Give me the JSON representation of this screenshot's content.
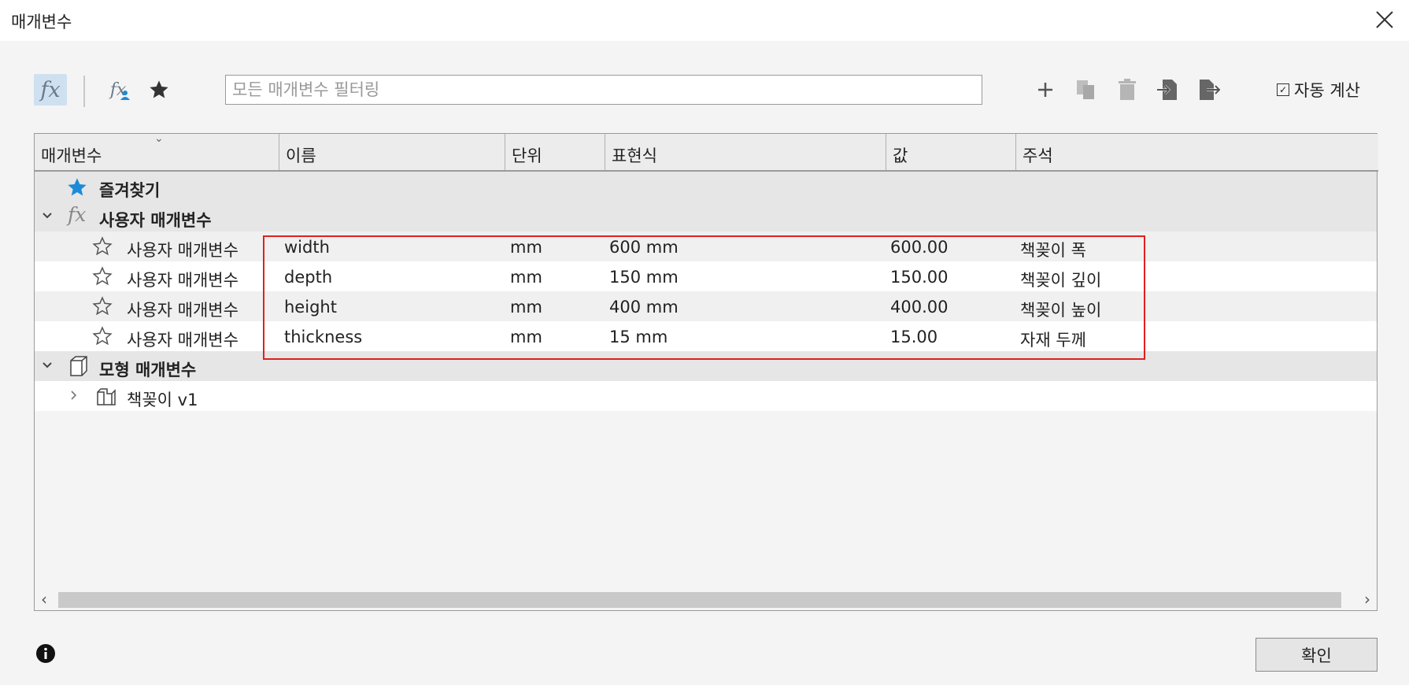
{
  "window": {
    "title": "매개변수",
    "close_icon": "close-icon"
  },
  "toolbar": {
    "filter_placeholder": "모든 매개변수 필터링",
    "fx_label": "fx",
    "user_fx_label": "fx",
    "auto_calc_label": "자동 계산",
    "auto_calc_checked": true,
    "checkmark": "✓"
  },
  "columns": [
    "매개변수",
    "이름",
    "단위",
    "표현식",
    "값",
    "주석"
  ],
  "groups": {
    "favorites": {
      "label": "즐겨찾기",
      "icon": "star-icon"
    },
    "user_params": {
      "label": "사용자 매개변수",
      "fx": "fx",
      "expanded": true
    },
    "model_params": {
      "label": "모형 매개변수",
      "expanded": true
    }
  },
  "rows": [
    {
      "type": "사용자 매개변수",
      "name": "width",
      "unit": "mm",
      "expression": "600 mm",
      "value": "600.00",
      "comment": "책꽂이 폭"
    },
    {
      "type": "사용자 매개변수",
      "name": "depth",
      "unit": "mm",
      "expression": "150 mm",
      "value": "150.00",
      "comment": "책꽂이 깊이"
    },
    {
      "type": "사용자 매개변수",
      "name": "height",
      "unit": "mm",
      "expression": "400 mm",
      "value": "400.00",
      "comment": "책꽂이 높이"
    },
    {
      "type": "사용자 매개변수",
      "name": "thickness",
      "unit": "mm",
      "expression": "15 mm",
      "value": "15.00",
      "comment": "자재 두께"
    }
  ],
  "model_component": {
    "label": "책꽂이 v1"
  },
  "footer": {
    "ok_label": "확인"
  },
  "colors": {
    "accent_blue": "#1a8bd8",
    "highlight_red": "#e02020",
    "fx_active_bg": "#cfe0f0"
  }
}
